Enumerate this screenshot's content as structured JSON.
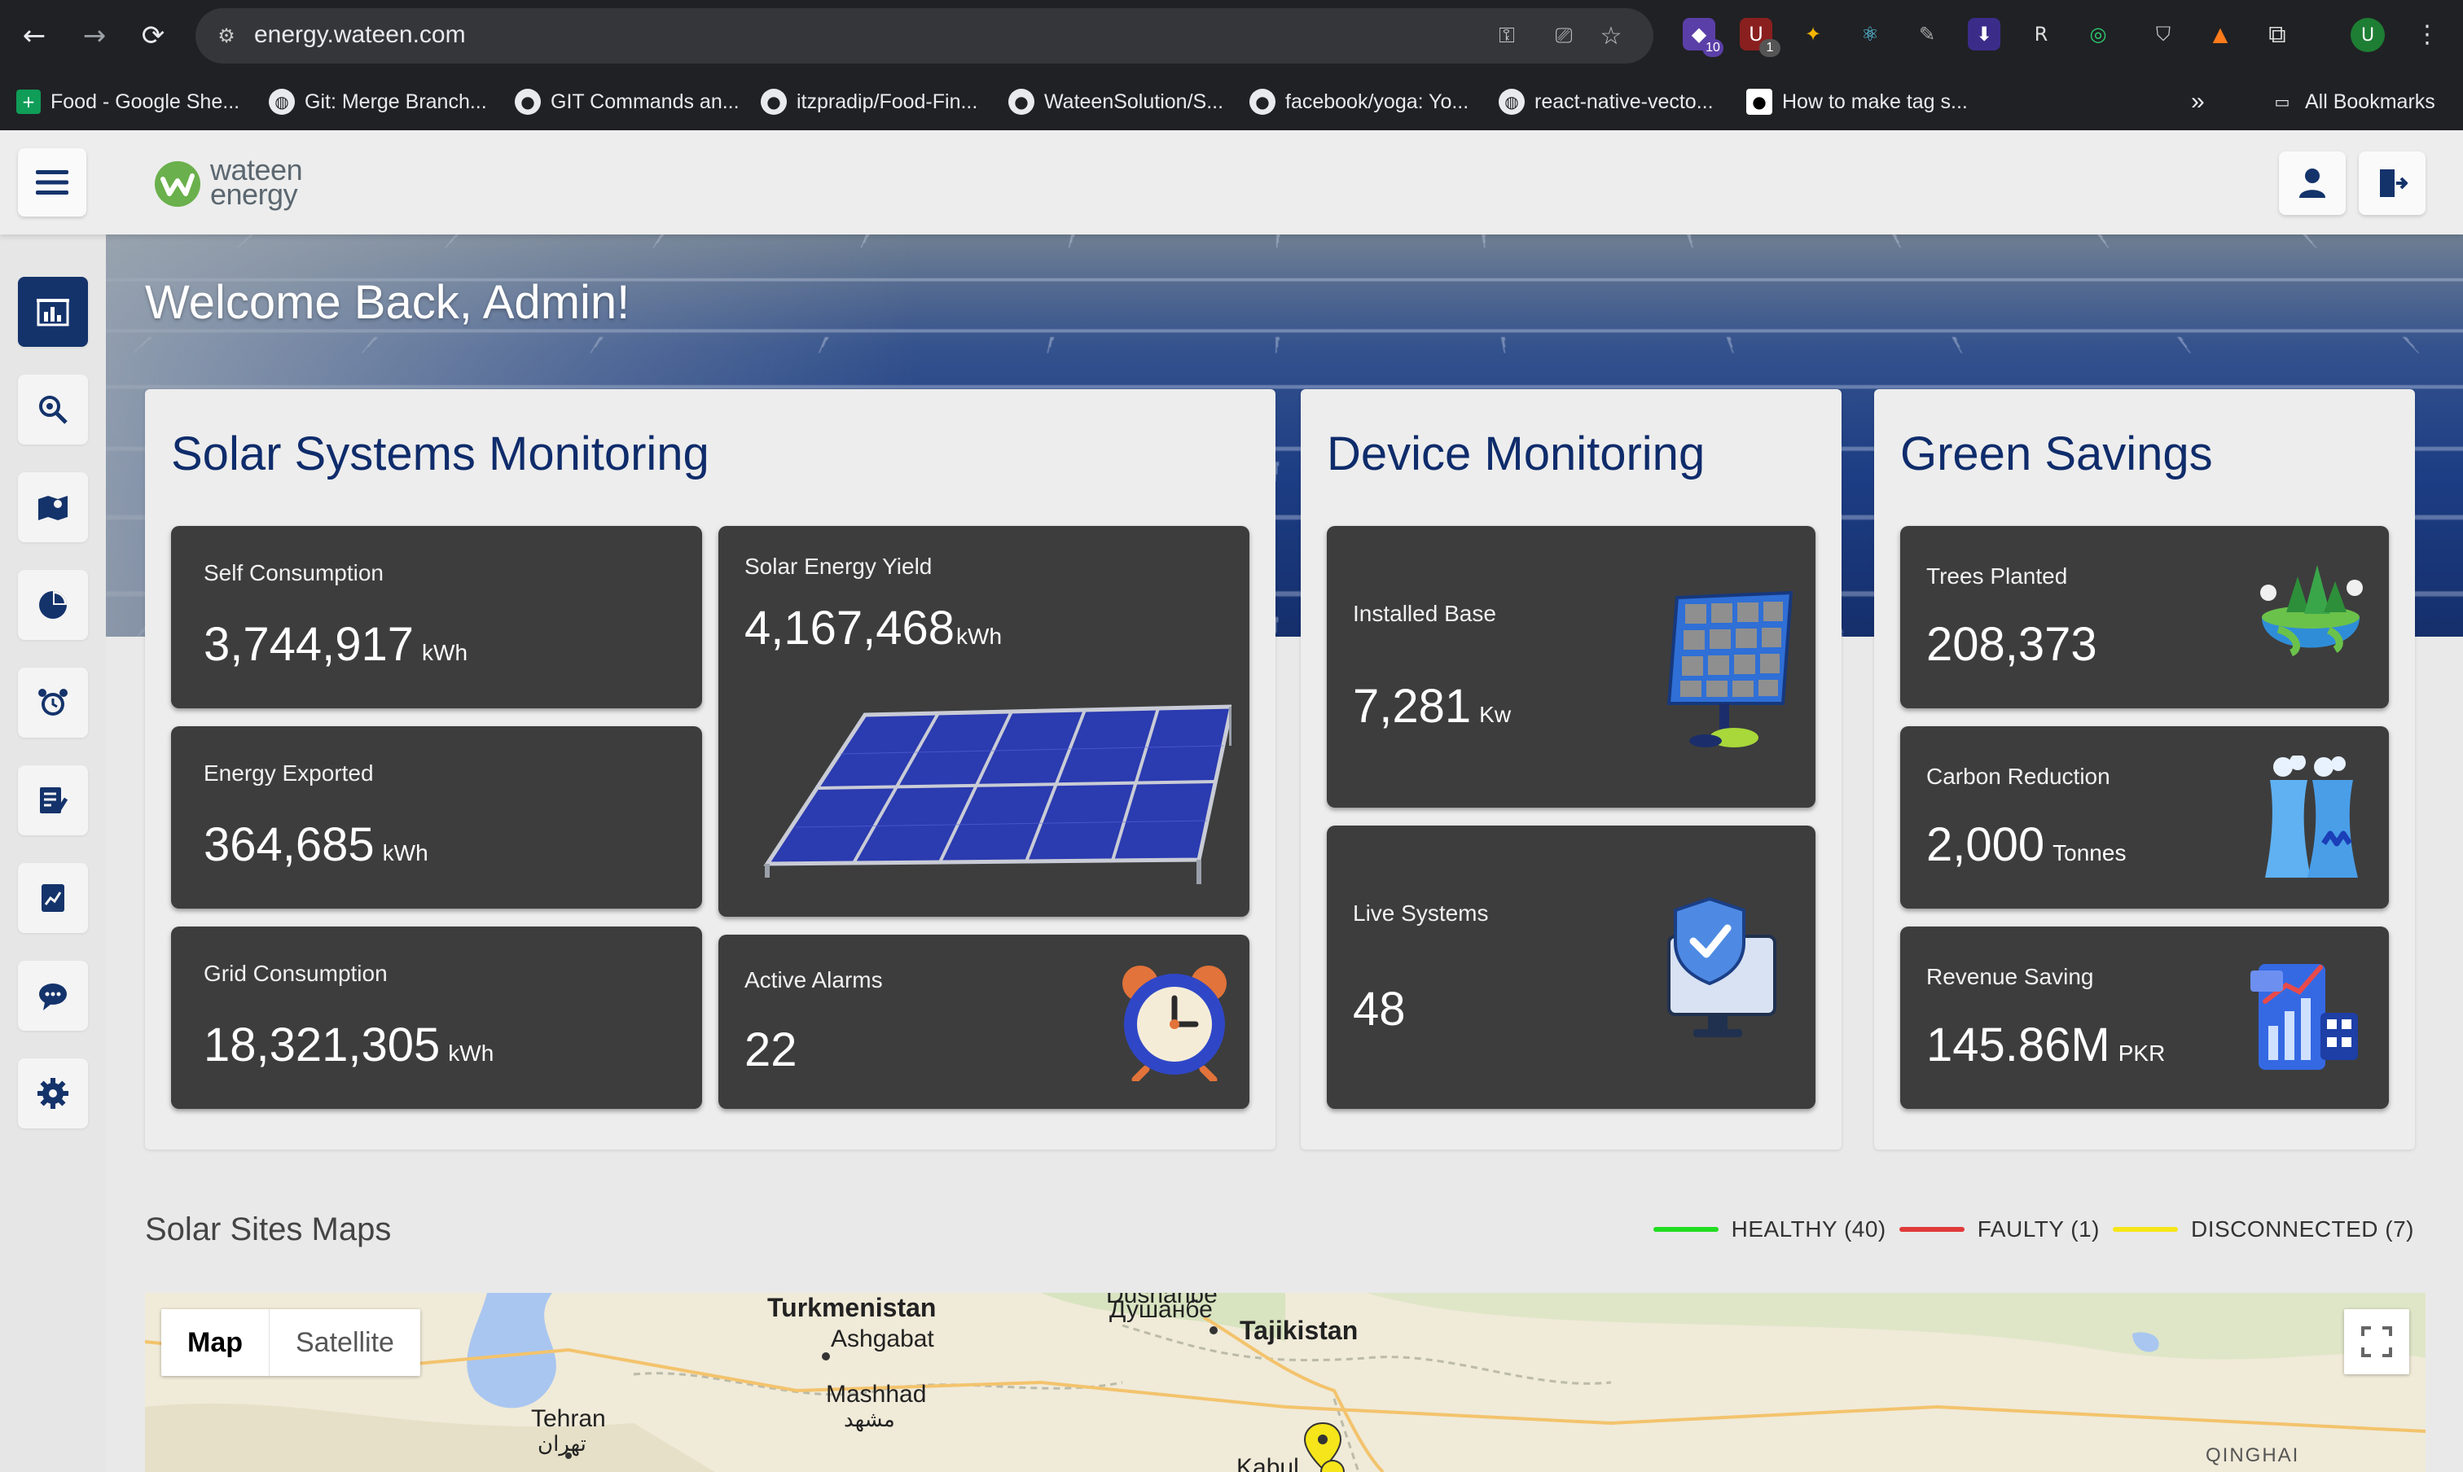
{
  "browser": {
    "url": "energy.wateen.com",
    "extension_badges": {
      "first": "10",
      "second": "1"
    },
    "profile_initial": "U",
    "bookmarks": [
      "Food - Google She...",
      "Git: Merge Branch...",
      "GIT Commands an...",
      "itzpradip/Food-Fin...",
      "WateenSolution/S...",
      "facebook/yoga: Yo...",
      "react-native-vecto...",
      "How to make tag s..."
    ],
    "all_bookmarks": "All Bookmarks"
  },
  "header": {
    "logo_line1": "wateen",
    "logo_line2": "energy"
  },
  "sidebar": {
    "items": [
      "dashboard",
      "site-settings",
      "map",
      "reports",
      "alarms",
      "tasks",
      "analytics",
      "support",
      "settings"
    ]
  },
  "hero": {
    "welcome": "Welcome Back, Admin!"
  },
  "solar": {
    "title": "Solar Systems Monitoring",
    "self_consumption": {
      "label": "Self Consumption",
      "value": "3,744,917",
      "unit": "kWh"
    },
    "energy_exported": {
      "label": "Energy Exported",
      "value": "364,685",
      "unit": "kWh"
    },
    "grid_consumption": {
      "label": "Grid Consumption",
      "value": "18,321,305",
      "unit": "kWh"
    },
    "solar_yield": {
      "label": "Solar Energy Yield",
      "value": "4,167,468",
      "unit": "kWh"
    },
    "active_alarms": {
      "label": "Active Alarms",
      "value": "22"
    }
  },
  "device": {
    "title": "Device Monitoring",
    "installed_base": {
      "label": "Installed Base",
      "value": "7,281",
      "unit": "Kw"
    },
    "live_systems": {
      "label": "Live Systems",
      "value": "48"
    }
  },
  "green": {
    "title": "Green Savings",
    "trees": {
      "label": "Trees Planted",
      "value": "208,373"
    },
    "carbon": {
      "label": "Carbon Reduction",
      "value": "2,000",
      "unit": "Tonnes"
    },
    "revenue": {
      "label": "Revenue Saving",
      "value": "145.86M",
      "unit": "PKR"
    }
  },
  "map_section": {
    "title": "Solar Sites Maps",
    "legend": [
      {
        "label": "HEALTHY (40)",
        "color": "#22dd22"
      },
      {
        "label": "FAULTY (1)",
        "color": "#e03a3a"
      },
      {
        "label": "DISCONNECTED (7)",
        "color": "#f5e51a"
      }
    ],
    "tabs": {
      "map": "Map",
      "satellite": "Satellite"
    },
    "places": {
      "turkmenistan": "Turkmenistan",
      "ashgabat": "Ashgabat",
      "mashhad": "Mashhad",
      "mashhad_local": "مشهد",
      "tehran": "Tehran",
      "tehran_local": "تهران",
      "dushanbe_local": "Душанбе",
      "dushanbe": "Dushanbe",
      "tajikistan": "Tajikistan",
      "kabul": "Kabul",
      "qinghai": "QINGHAI"
    }
  },
  "colors": {
    "navy": "#0f2c6b",
    "tile": "#3d3d3d",
    "sidebar_active": "#14336b"
  }
}
